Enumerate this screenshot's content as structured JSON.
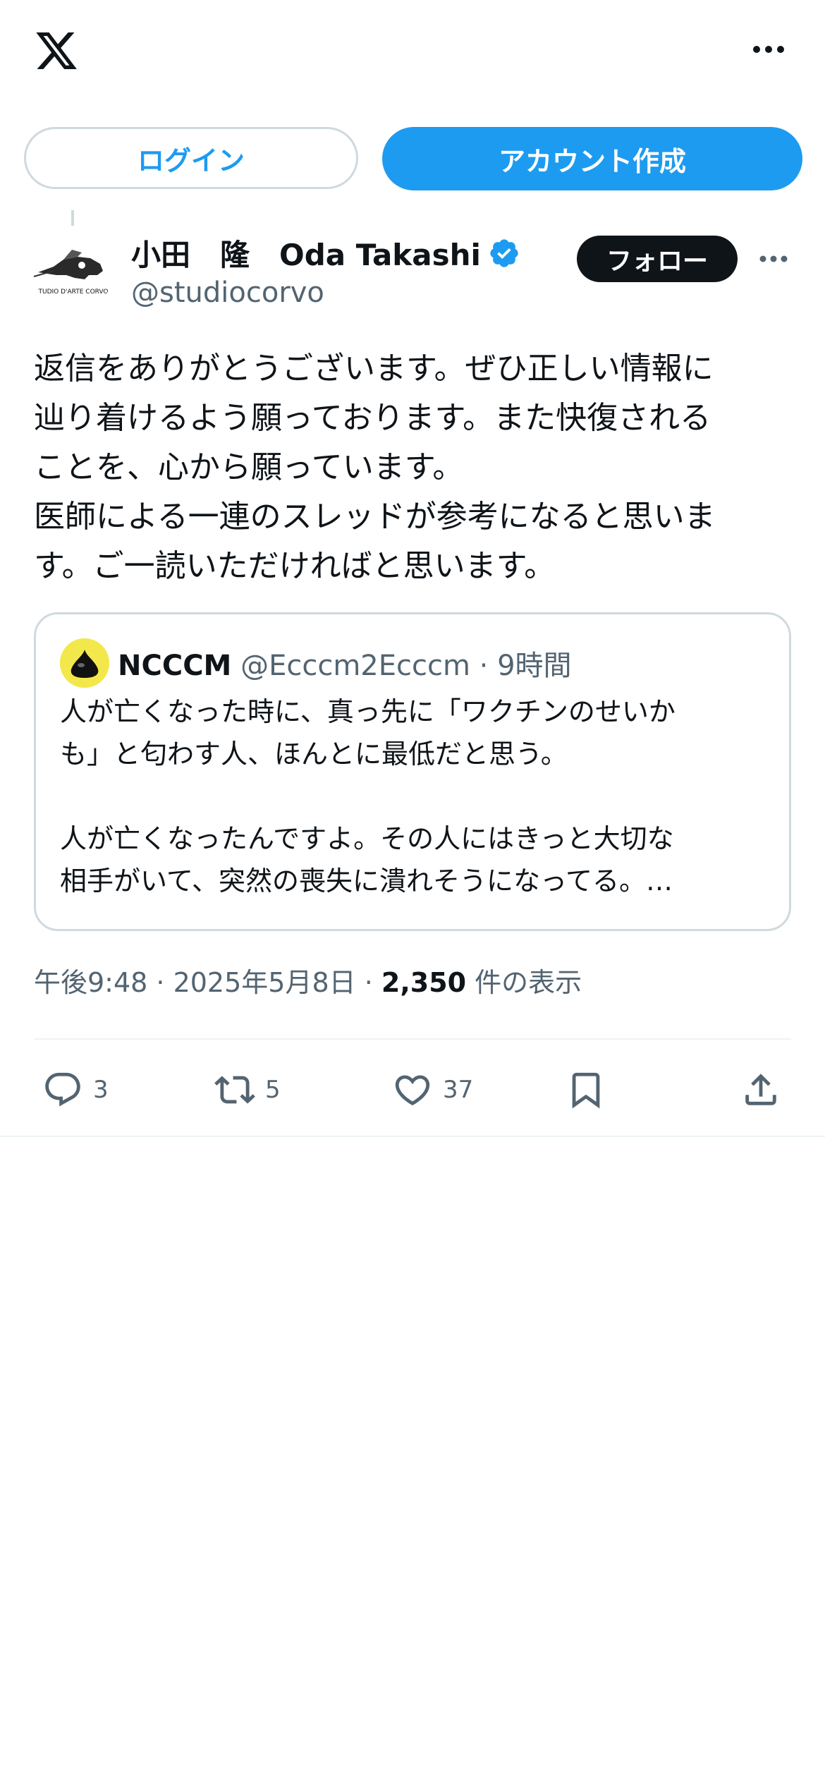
{
  "header": {
    "logo_icon": "x-logo-icon",
    "more_icon": "more-horizontal-icon"
  },
  "auth": {
    "login_label": "ログイン",
    "signup_label": "アカウント作成"
  },
  "post": {
    "author_name": "小田　隆　Oda Takashi",
    "author_handle": "@studiocorvo",
    "avatar_text": "TUDIO D'ARTE CORVO",
    "follow_label": "フォロー",
    "text": "返信をありがとうございます。ぜひ正しい情報に\n辿り着けるよう願っております。また快復される\nことを、心から願っています。\n医師による一連のスレッドが参考になると思いま\nす。ご一読いただければと思います。",
    "quote": {
      "name": "NCCCM",
      "handle_time": "@Ecccm2Ecccm · 9時間",
      "text": "人が亡くなった時に、真っ先に「ワクチンのせいか\nも」と匂わす人、ほんとに最低だと思う。\n\n人が亡くなったんですよ。その人にはきっと大切な\n相手がいて、突然の喪失に潰れそうになってる。…"
    },
    "meta_time": "午後9:48 · 2025年5月8日 · ",
    "meta_views": "2,350",
    "meta_views_label": " 件の表示",
    "accent_color": "#1d9bf0"
  },
  "actions": {
    "reply_count": "3",
    "repost_count": "5",
    "like_count": "37"
  }
}
